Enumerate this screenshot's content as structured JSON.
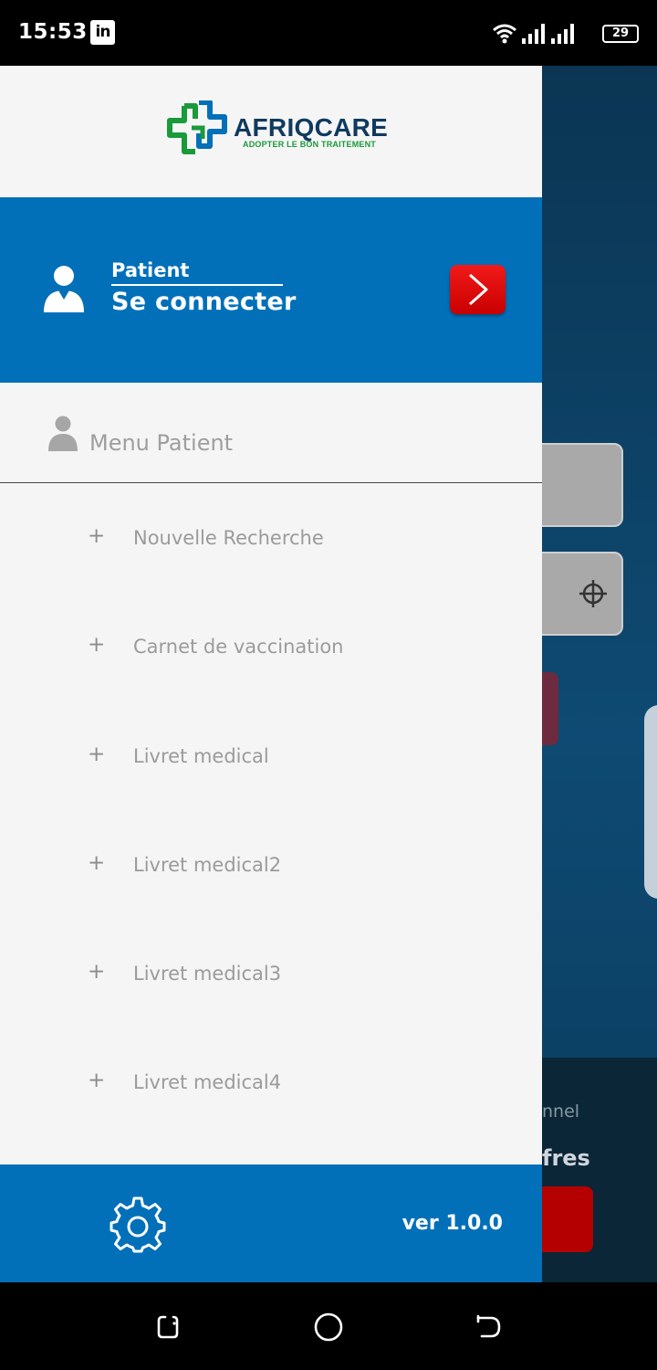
{
  "status_bar": {
    "time": "15:53",
    "app_badge": "in",
    "battery": "29",
    "icons": [
      "linkedin-icon",
      "wifi-icon",
      "signal-icon",
      "signal-icon",
      "battery-icon"
    ]
  },
  "background_app": {
    "partial_label": "nnel",
    "partial_heading": "fres",
    "icons": [
      "crosshair-icon"
    ]
  },
  "drawer": {
    "logo": {
      "name": "AFRIQCARE",
      "tagline": "ADOPTER LE BON TRAITEMENT"
    },
    "login": {
      "role": "Patient",
      "action": "Se connecter",
      "icons": [
        "user-icon",
        "chevron-right-icon"
      ]
    },
    "menu_header": {
      "label": "Menu Patient",
      "icon": "user-icon"
    },
    "menu_items": [
      {
        "label": "Nouvelle Recherche",
        "icon": "plus-icon"
      },
      {
        "label": "Carnet de vaccination",
        "icon": "plus-icon"
      },
      {
        "label": "Livret medical",
        "icon": "plus-icon"
      },
      {
        "label": "Livret medical2",
        "icon": "plus-icon"
      },
      {
        "label": "Livret medical3",
        "icon": "plus-icon"
      },
      {
        "label": "Livret medical4",
        "icon": "plus-icon"
      }
    ],
    "footer": {
      "version": "ver 1.0.0",
      "icon": "gear-icon"
    }
  },
  "nav_bar": {
    "icons": [
      "recent-apps-icon",
      "home-icon",
      "back-icon"
    ]
  },
  "colors": {
    "primary_blue": "#0270b9",
    "drawer_bg": "#f5f5f5",
    "accent_red": "#e00000",
    "logo_green": "#1a9a3a",
    "logo_blue": "#0f3a5f",
    "menu_text": "#9b9b9b"
  }
}
